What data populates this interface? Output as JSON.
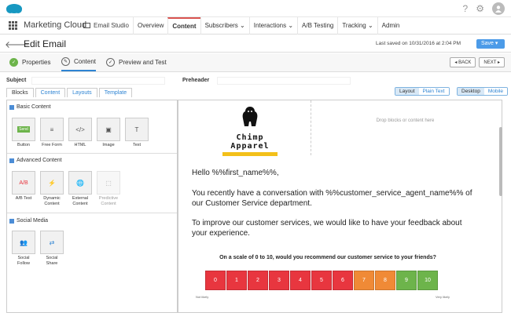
{
  "topbar": {
    "help": "?",
    "settings": "⚙",
    "avatar": "👤"
  },
  "navbar": {
    "app_name": "Marketing Cloud",
    "studio": "Email Studio",
    "items": [
      "Overview",
      "Content",
      "Subscribers ⌄",
      "Interactions ⌄",
      "A/B Testing",
      "Tracking ⌄",
      "Admin"
    ]
  },
  "titlebar": {
    "back": "🡐",
    "title": "Edit Email",
    "saved": "Last saved on 10/31/2016 at 2:04 PM",
    "save": "Save ▾"
  },
  "steps": [
    {
      "label": "Properties",
      "icon": "✓"
    },
    {
      "label": "Content",
      "icon": "✎"
    },
    {
      "label": "Preview and Test",
      "icon": "✓"
    }
  ],
  "navbtns": {
    "back": "◂ BACK",
    "next": "NEXT ▸"
  },
  "fields": {
    "subject_label": "Subject",
    "preheader_label": "Preheader"
  },
  "tabs": [
    "Blocks",
    "Content",
    "Layouts",
    "Template"
  ],
  "view_toggle": [
    "Layout",
    "Plain Text"
  ],
  "device_toggle": [
    "Desktop",
    "Mobile"
  ],
  "sections": {
    "basic": {
      "title": "Basic Content",
      "blocks": [
        {
          "label": "Button",
          "icon": "Send"
        },
        {
          "label": "Free Form",
          "icon": "≡"
        },
        {
          "label": "HTML",
          "icon": "</>"
        },
        {
          "label": "Image",
          "icon": "▣"
        },
        {
          "label": "Text",
          "icon": "T"
        }
      ]
    },
    "advanced": {
      "title": "Advanced Content",
      "blocks": [
        {
          "label": "A/B Test",
          "icon": "A/B"
        },
        {
          "label": "Dynamic Content",
          "icon": "⚡"
        },
        {
          "label": "External Content",
          "icon": "🌐"
        },
        {
          "label": "Predictive Content",
          "icon": "⬚"
        }
      ]
    },
    "social": {
      "title": "Social Media",
      "blocks": [
        {
          "label": "Social Follow",
          "icon": "👥"
        },
        {
          "label": "Social Share",
          "icon": "⇄"
        }
      ]
    }
  },
  "email": {
    "drop_hint": "Drop blocks or content here",
    "logo_name": "Chimp Apparel",
    "greeting": "Hello %%first_name%%,",
    "para1": "You recently have a conversation with %%customer_service_agent_name%% of our Customer Service department.",
    "para2": "To improve our customer services, we would like to have your feedback about your experience.",
    "question": "On a scale of 0 to 10, would you recommend our customer service to your friends?",
    "scale": [
      "0",
      "1",
      "2",
      "3",
      "4",
      "5",
      "6",
      "7",
      "8",
      "9",
      "10"
    ],
    "scale_colors": [
      "#e8363f",
      "#e8363f",
      "#e8363f",
      "#e8363f",
      "#e8363f",
      "#e8363f",
      "#e8363f",
      "#f08a36",
      "#f08a36",
      "#6db44b",
      "#6db44b"
    ],
    "low_label": "Not likely",
    "high_label": "Very likely"
  }
}
